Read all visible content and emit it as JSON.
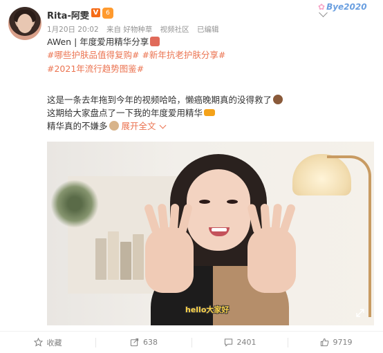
{
  "header": {
    "username": "Rita-阿雯",
    "vip_badge": "V",
    "level_badge": "6",
    "meta": {
      "time": "1月20日 20:02",
      "source": "来自 好物种草",
      "visibility": "视频社区",
      "edited": "已编辑"
    },
    "watermark": "Bye2020"
  },
  "post": {
    "title_line": "AWen | 年度爱用精华分享",
    "hashtags": [
      "#哪些护肤品值得复购#",
      "#新年抗老护肤分享#",
      "#2021年流行趋势图鉴#"
    ],
    "line1": "这是一条去年拖到今年的视频哈哈，懒癌晚期真的没得救了",
    "line2": "这期给大家盘点了一下我的年度爱用精华",
    "line3": "精华真的不嫌多",
    "expand_label": "展开全文"
  },
  "video": {
    "subtitle": "hello大家好"
  },
  "footer": {
    "favorite_label": "收藏",
    "repost_count": "638",
    "comment_count": "2401",
    "like_count": "9719"
  },
  "icons": {
    "favorite": "star-icon",
    "repost": "share-icon",
    "comment": "comment-icon",
    "like": "thumbs-up-icon"
  },
  "colors": {
    "accent": "#eb7350",
    "text": "#333333",
    "meta": "#939393",
    "vip": "#f56c18"
  }
}
